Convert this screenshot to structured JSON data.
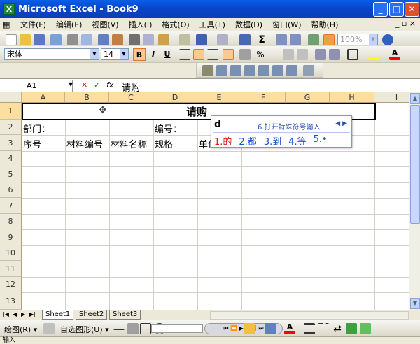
{
  "window": {
    "title": "Microsoft Excel - Book9",
    "controls": {
      "minimize": "_",
      "maximize": "□",
      "close": "✕"
    }
  },
  "menubar": {
    "items": [
      "文件(F)",
      "编辑(E)",
      "视图(V)",
      "插入(I)",
      "格式(O)",
      "工具(T)",
      "数据(D)",
      "窗口(W)",
      "帮助(H)"
    ],
    "right_controls": "_ ▫ ×"
  },
  "standard_toolbar": {
    "zoom": "100%"
  },
  "formatting_toolbar": {
    "font_name": "宋体",
    "font_size": "14",
    "bold_label": "B",
    "italic_label": "I",
    "underline_label": "U",
    "percent_label": "%",
    "accent_color": "#ffc890",
    "fill_color": "#ffff00",
    "font_color": "#ff0000"
  },
  "formula_bar": {
    "name_box": "A1",
    "cancel_icon": "✕",
    "enter_icon": "✓",
    "fx_label": "fx",
    "content": "请购"
  },
  "sheet": {
    "columns": [
      "A",
      "B",
      "C",
      "D",
      "E",
      "F",
      "G",
      "H",
      "I"
    ],
    "rows": [
      "1",
      "2",
      "3",
      "4",
      "5",
      "6",
      "7",
      "8",
      "9",
      "10",
      "11",
      "12",
      "13"
    ],
    "cells": {
      "title": "请购",
      "dept_label": "部门：",
      "number_label": "编号：",
      "seq_header": "序号",
      "material_code": "材料编号",
      "material_name": "材料名称",
      "spec": "规格",
      "unit": "单位"
    }
  },
  "ime": {
    "input": "d",
    "hint": "6.打开特殊符号输入",
    "nav": "◀ ▶",
    "candidates": [
      "1.的",
      "2.都",
      "3.到",
      "4.等",
      "5.•"
    ]
  },
  "sheet_tabs": [
    "Sheet1",
    "Sheet2",
    "Sheet3"
  ],
  "draw_toolbar": {
    "draw_label": "绘图(R) ▾",
    "autoshape_label": "自选图形(U) ▾"
  },
  "status": {
    "mode": "输入"
  }
}
